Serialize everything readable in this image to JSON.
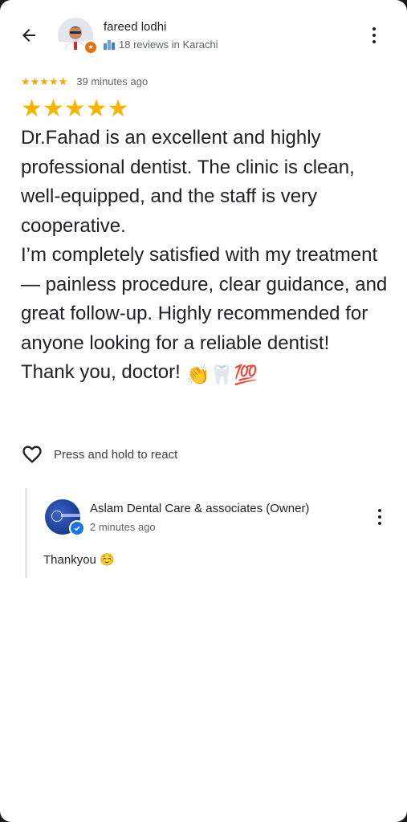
{
  "header": {
    "back_icon": "arrow-back-icon",
    "user_name": "fareed lodhi",
    "user_meta": "18 reviews in Karachi",
    "badge_icon": "local-guide-star-icon",
    "more_icon": "more-vert-icon"
  },
  "review": {
    "rating": 5,
    "stars_small": "★★★★★",
    "time_ago": "39 minutes ago",
    "stars_big": "★★★★★",
    "text": "Dr.Fahad is an excellent and highly professional dentist. The clinic is clean, well-equipped, and the staff is very cooperative.\nI’m completely satisfied with my treatment — painless procedure, clear guidance, and great follow-up. Highly recommended for anyone looking for a reliable dentist!\nThank you, doctor!",
    "emojis": "👏🦷💯"
  },
  "react": {
    "label": "Press and hold to react",
    "icon": "heart-outline-icon"
  },
  "owner_reply": {
    "name": "Aslam Dental Care & associates (Owner)",
    "time_ago": "2 minutes ago",
    "text": "Thankyou ☺️",
    "verified_icon": "verified-check-icon"
  },
  "colors": {
    "star": "#f7b500",
    "badge": "#e8710a",
    "verified": "#1a73e8"
  }
}
